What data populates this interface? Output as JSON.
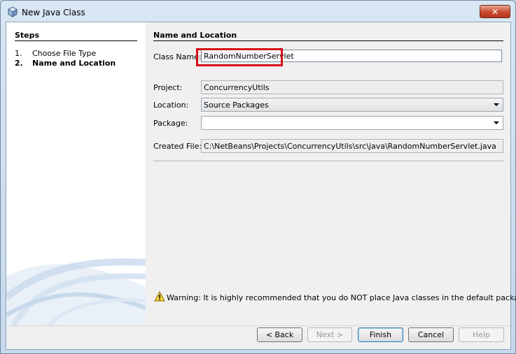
{
  "window": {
    "title": "New Java Class",
    "close_label": "✕"
  },
  "steps": {
    "title": "Steps",
    "items": [
      {
        "number": "1.",
        "label": "Choose File Type",
        "current": false
      },
      {
        "number": "2.",
        "label": "Name and Location",
        "current": true
      }
    ]
  },
  "panel": {
    "title": "Name and Location",
    "class_name": {
      "label": "Class Name:",
      "value": "RandomNumberServlet"
    },
    "project": {
      "label": "Project:",
      "value": "ConcurrencyUtils"
    },
    "location": {
      "label": "Location:",
      "value": "Source Packages"
    },
    "package": {
      "label": "Package:",
      "value": ""
    },
    "created_file": {
      "label": "Created File:",
      "value": "C:\\NetBeans\\Projects\\ConcurrencyUtils\\src\\java\\RandomNumberServlet.java"
    }
  },
  "warning": {
    "icon": "warning-icon",
    "text": "Warning: It is highly recommended that you do NOT place Java classes in the default package."
  },
  "buttons": {
    "back": "< Back",
    "next": "Next >",
    "finish": "Finish",
    "cancel": "Cancel",
    "help": "Help"
  },
  "colors": {
    "highlight": "#d60c19",
    "title_bar": "#c6d8ea",
    "close_button": "#c94b2f"
  }
}
